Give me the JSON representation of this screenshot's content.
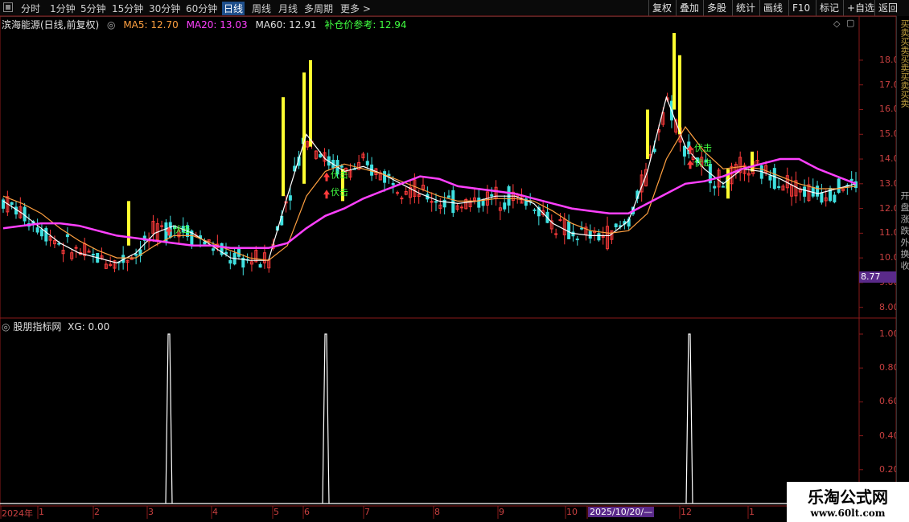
{
  "toolbar": {
    "timeframes": [
      "分时",
      "1分钟",
      "5分钟",
      "15分钟",
      "30分钟",
      "60分钟",
      "日线",
      "周线",
      "月线",
      "多周期",
      "更多 >"
    ],
    "active": "日线",
    "right_buttons": [
      "复权",
      "叠加",
      "多股",
      "统计",
      "画线",
      "F10",
      "标记",
      "+自选",
      "返回"
    ]
  },
  "main": {
    "stock": "滨海能源(日线,前复权)",
    "ma5": "MA5: 12.70",
    "ma20": "MA20: 13.03",
    "ma60": "MA60: 12.91",
    "ref": "补仓价参考: 12.94",
    "price_tag": "8.77",
    "y_ticks": [
      "18.00",
      "17.00",
      "16.00",
      "15.00",
      "14.00",
      "13.00",
      "12.00",
      "11.00",
      "10.00",
      "9.00",
      "8.00"
    ],
    "signal_text": "伏击"
  },
  "indicator": {
    "title": "股朋指标网",
    "xg": "XG: 0.00",
    "y_ticks": [
      "1.00",
      "0.80",
      "0.60",
      "0.40",
      "0.20"
    ]
  },
  "dates": [
    "2024年",
    "1",
    "2",
    "3",
    "4",
    "5",
    "6",
    "7",
    "8",
    "9",
    "10",
    "2025/10/20/—",
    "12",
    "1"
  ],
  "side_text": [
    "买卖买卖买卖买卖买卖",
    "开 盘 涨 跌 外 换 收"
  ],
  "watermark": {
    "line1": "乐淘公式网",
    "line2": "www.60lt.com"
  },
  "colors": {
    "up": "#ff3b3b",
    "down": "#3fe0e0",
    "ma5": "#ffffff",
    "ma20": "#ffa040",
    "ma60": "#ff40ff",
    "yellow": "#ffff30",
    "green": "#40ff40"
  },
  "chart_data": {
    "type": "line",
    "title": "滨海能源(日线,前复权)",
    "ylim": [
      7.6,
      19.2
    ],
    "series": [
      {
        "name": "MA5",
        "values": [
          12.3,
          11.8,
          11.2,
          10.6,
          10.2,
          10.0,
          9.8,
          10.2,
          11.0,
          11.3,
          11.0,
          10.5,
          10.0,
          9.9,
          9.9,
          12.5,
          15.0,
          14.0,
          13.5,
          13.7,
          13.4,
          13.0,
          12.6,
          12.3,
          12.2,
          12.3,
          12.5,
          12.5,
          12.2,
          11.4,
          11.0,
          10.9,
          10.9,
          11.5,
          13.5,
          16.5,
          14.5,
          13.6,
          13.0,
          13.6,
          13.5,
          13.2,
          12.8,
          12.6,
          12.8,
          13.0
        ]
      },
      {
        "name": "MA20",
        "values": [
          12.5,
          12.2,
          11.8,
          11.2,
          10.7,
          10.3,
          10.0,
          10.0,
          10.5,
          10.9,
          10.9,
          10.6,
          10.3,
          10.0,
          9.9,
          10.5,
          12.5,
          13.5,
          13.8,
          13.6,
          13.4,
          13.1,
          12.8,
          12.5,
          12.3,
          12.3,
          12.4,
          12.4,
          12.3,
          11.9,
          11.4,
          11.1,
          11.0,
          11.1,
          11.8,
          14.0,
          15.3,
          14.3,
          13.6,
          13.7,
          13.6,
          13.3,
          13.0,
          12.8,
          12.8,
          12.9
        ]
      },
      {
        "name": "MA60",
        "values": [
          11.2,
          11.3,
          11.4,
          11.4,
          11.3,
          11.1,
          10.9,
          10.8,
          10.7,
          10.6,
          10.5,
          10.5,
          10.4,
          10.4,
          10.4,
          10.6,
          11.2,
          11.7,
          12.0,
          12.4,
          12.7,
          13.0,
          13.3,
          13.2,
          12.9,
          12.8,
          12.7,
          12.6,
          12.4,
          12.2,
          12.0,
          11.9,
          11.8,
          11.8,
          12.2,
          12.6,
          13.0,
          13.1,
          13.3,
          13.6,
          13.8,
          14.0,
          14.0,
          13.6,
          13.3,
          13.0
        ]
      }
    ],
    "indicator_xg_spikes": [
      1.0,
      1.0,
      1.0
    ]
  }
}
